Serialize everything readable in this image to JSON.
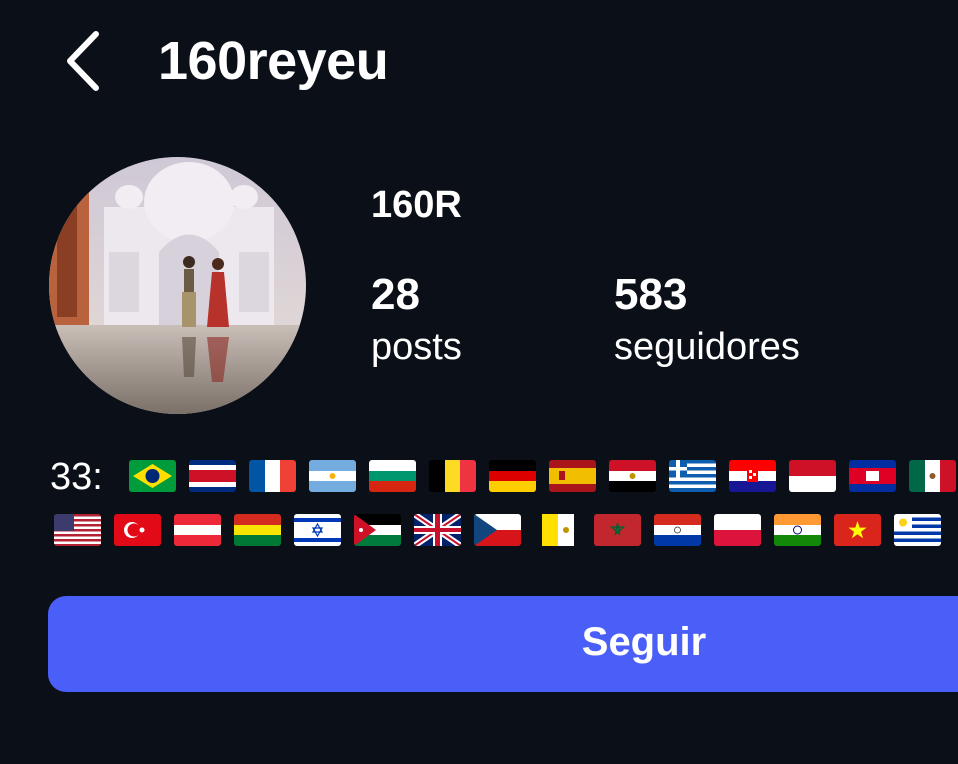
{
  "header": {
    "back_icon": "chevron-left-icon",
    "username": "160reyeu"
  },
  "profile": {
    "avatar_alt": "profile photo",
    "display_name": "160R",
    "stats": {
      "posts_count": "28",
      "posts_label": "posts",
      "followers_count": "583",
      "followers_label": "seguidores"
    }
  },
  "flags": {
    "count_label": "33:",
    "row1": [
      "brazil-flag",
      "costa-rica-flag",
      "france-flag",
      "argentina-flag",
      "bulgaria-flag",
      "belgium-flag",
      "germany-flag",
      "spain-flag",
      "egypt-flag",
      "greece-flag",
      "croatia-flag",
      "indonesia-flag",
      "cambodia-flag",
      "mexico-flag"
    ],
    "row2": [
      "usa-flag",
      "turkey-flag",
      "austria-flag",
      "bolivia-flag",
      "israel-flag",
      "jordan-flag",
      "uk-flag",
      "czech-flag",
      "vatican-flag",
      "morocco-flag",
      "paraguay-flag",
      "poland-flag",
      "india-flag",
      "vietnam-flag",
      "uruguay-flag"
    ]
  },
  "actions": {
    "follow_label": "Seguir"
  },
  "colors": {
    "background": "#0b0f17",
    "accent": "#4a5ff7",
    "text": "#ffffff"
  }
}
